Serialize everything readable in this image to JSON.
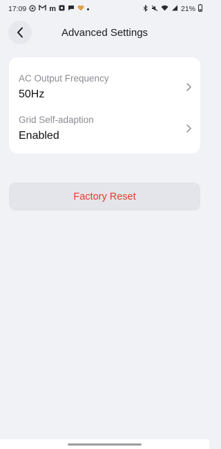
{
  "status_bar": {
    "time": "17:09",
    "battery": "21%",
    "left_icons": [
      "whatsapp-icon",
      "gmail-icon",
      "m-icon",
      "app-icon",
      "chat-icon",
      "heart-icon"
    ],
    "right_icons": [
      "bluetooth-icon",
      "mute-icon",
      "wifi-icon",
      "signal-icon"
    ]
  },
  "header": {
    "title": "Advanced Settings",
    "back_icon": "chevron-left-icon"
  },
  "settings": [
    {
      "label": "AC Output Frequency",
      "value": "50Hz"
    },
    {
      "label": "Grid Self-adaption",
      "value": "Enabled"
    }
  ],
  "factory_reset": {
    "label": "Factory Reset",
    "color": "#e53b2f"
  },
  "colors": {
    "background": "#f1f2f6",
    "card": "#ffffff",
    "reset_button_bg": "#e4e5ea"
  }
}
